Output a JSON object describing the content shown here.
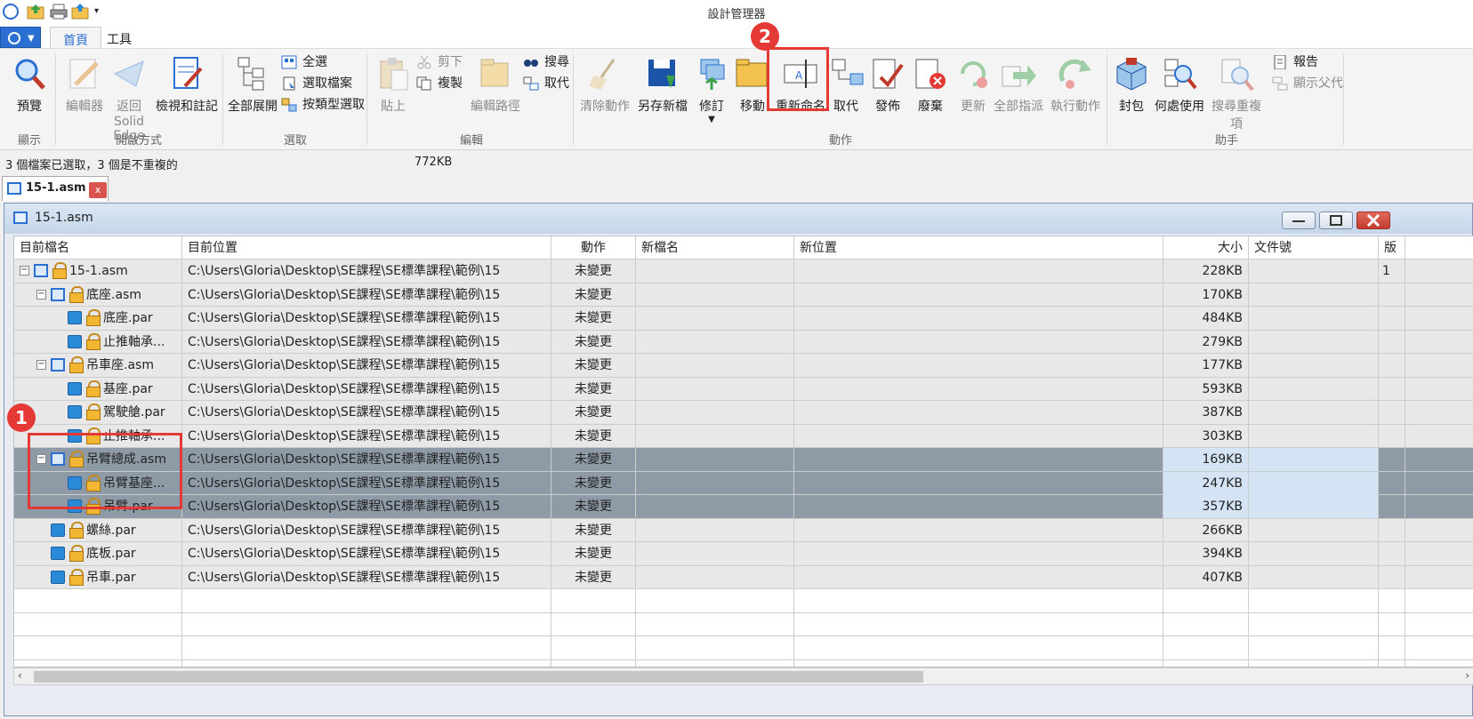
{
  "app_title": "設計管理器",
  "ribbon_tabs": [
    "首頁",
    "工具"
  ],
  "ribbon": {
    "preview": "預覽",
    "editor": "編輯器",
    "return_line1": "返回 Solid",
    "return_line2": "Edge",
    "inspect": "檢視和註記",
    "expand_all": "全部展開",
    "select_all": "全選",
    "select_files": "選取檔案",
    "select_by_type": "按類型選取",
    "paste": "貼上",
    "cut": "剪下",
    "copy": "複製",
    "edit_path": "編輯路徑",
    "search": "搜尋",
    "replace_small": "取代",
    "clear_action": "清除動作",
    "save_as_new": "另存新檔",
    "revise": "修訂",
    "move": "移動",
    "rename": "重新命名",
    "replace": "取代",
    "publish": "發佈",
    "obsolete": "廢棄",
    "update": "更新",
    "assign_all": "全部指派",
    "execute": "執行動作",
    "pack": "封包",
    "where_used": "何處使用",
    "find_duplicates": "搜尋重複項",
    "report": "報告",
    "show_parent": "顯示父代"
  },
  "groups": [
    "顯示",
    "開啟方式",
    "選取",
    "編輯",
    "動作",
    "助手"
  ],
  "status": {
    "selection": "3 個檔案已選取，3 個是不重複的",
    "size": "772KB"
  },
  "doc_tab": {
    "name": "15-1.asm",
    "close": "x"
  },
  "window_title": "15-1.asm",
  "columns": [
    "目前檔名",
    "目前位置",
    "動作",
    "新檔名",
    "新位置",
    "大小",
    "文件號",
    "版"
  ],
  "rows": [
    {
      "name": "15-1.asm",
      "location": "C:\\Users\\Gloria\\Desktop\\SE課程\\SE標準課程\\範例\\15",
      "action": "未變更",
      "size": "228KB",
      "rev": "1"
    },
    {
      "name": "底座.asm",
      "location": "C:\\Users\\Gloria\\Desktop\\SE課程\\SE標準課程\\範例\\15",
      "action": "未變更",
      "size": "170KB",
      "rev": ""
    },
    {
      "name": "底座.par",
      "location": "C:\\Users\\Gloria\\Desktop\\SE課程\\SE標準課程\\範例\\15",
      "action": "未變更",
      "size": "484KB",
      "rev": ""
    },
    {
      "name": "止推軸承...",
      "location": "C:\\Users\\Gloria\\Desktop\\SE課程\\SE標準課程\\範例\\15",
      "action": "未變更",
      "size": "279KB",
      "rev": ""
    },
    {
      "name": "吊車座.asm",
      "location": "C:\\Users\\Gloria\\Desktop\\SE課程\\SE標準課程\\範例\\15",
      "action": "未變更",
      "size": "177KB",
      "rev": ""
    },
    {
      "name": "基座.par",
      "location": "C:\\Users\\Gloria\\Desktop\\SE課程\\SE標準課程\\範例\\15",
      "action": "未變更",
      "size": "593KB",
      "rev": ""
    },
    {
      "name": "駕駛艙.par",
      "location": "C:\\Users\\Gloria\\Desktop\\SE課程\\SE標準課程\\範例\\15",
      "action": "未變更",
      "size": "387KB",
      "rev": ""
    },
    {
      "name": "止推軸承...",
      "location": "C:\\Users\\Gloria\\Desktop\\SE課程\\SE標準課程\\範例\\15",
      "action": "未變更",
      "size": "303KB",
      "rev": ""
    },
    {
      "name": "吊臂總成.asm",
      "location": "C:\\Users\\Gloria\\Desktop\\SE課程\\SE標準課程\\範例\\15",
      "action": "未變更",
      "size": "169KB",
      "rev": ""
    },
    {
      "name": "吊臂基座...",
      "location": "C:\\Users\\Gloria\\Desktop\\SE課程\\SE標準課程\\範例\\15",
      "action": "未變更",
      "size": "247KB",
      "rev": ""
    },
    {
      "name": "吊臂.par",
      "location": "C:\\Users\\Gloria\\Desktop\\SE課程\\SE標準課程\\範例\\15",
      "action": "未變更",
      "size": "357KB",
      "rev": ""
    },
    {
      "name": "螺絲.par",
      "location": "C:\\Users\\Gloria\\Desktop\\SE課程\\SE標準課程\\範例\\15",
      "action": "未變更",
      "size": "266KB",
      "rev": ""
    },
    {
      "name": "底板.par",
      "location": "C:\\Users\\Gloria\\Desktop\\SE課程\\SE標準課程\\範例\\15",
      "action": "未變更",
      "size": "394KB",
      "rev": ""
    },
    {
      "name": "吊車.par",
      "location": "C:\\Users\\Gloria\\Desktop\\SE課程\\SE標準課程\\範例\\15",
      "action": "未變更",
      "size": "407KB",
      "rev": ""
    }
  ],
  "annotations": [
    "1",
    "2"
  ],
  "colors": {
    "accent": "#2a6fd1",
    "selected_row": "#8e9aa6",
    "highlight": "#e53935"
  }
}
